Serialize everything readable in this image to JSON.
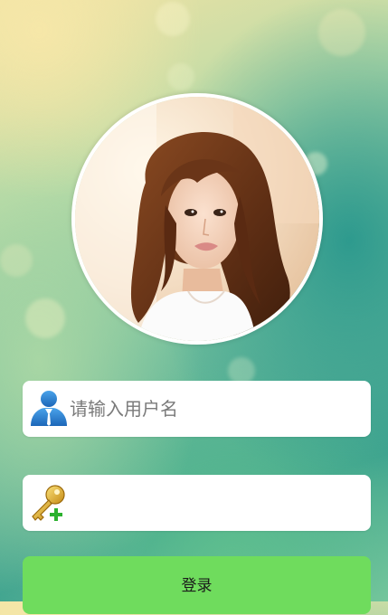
{
  "avatar": {
    "description_icon": "profile-photo"
  },
  "username_field": {
    "icon": "user-icon",
    "placeholder": "请输入用户名",
    "value": ""
  },
  "password_field": {
    "icon": "key-add-icon",
    "placeholder": "",
    "value": ""
  },
  "login_button": {
    "label": "登录"
  },
  "colors": {
    "button": "#6fdc5d",
    "field_background": "#ffffff",
    "avatar_border": "#ffffff"
  }
}
